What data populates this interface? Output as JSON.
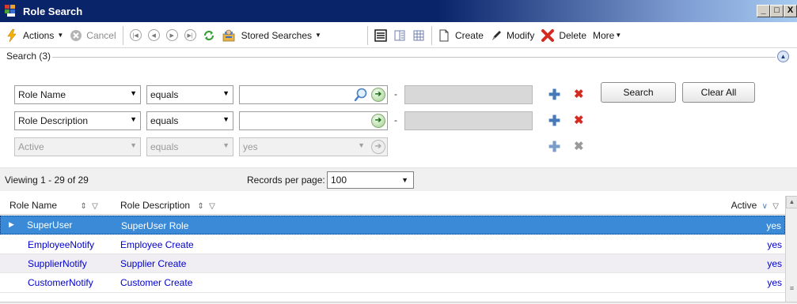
{
  "window": {
    "title": "Role Search",
    "minimize": "_",
    "maximize": "□",
    "close": "X"
  },
  "toolbar": {
    "actions": "Actions",
    "cancel": "Cancel",
    "stored_searches": "Stored Searches",
    "create": "Create",
    "modify": "Modify",
    "delete": "Delete",
    "more": "More"
  },
  "search": {
    "legend": "Search (3)",
    "rows": [
      {
        "field": "Role Name",
        "operator": "equals",
        "value": "",
        "range_to": ""
      },
      {
        "field": "Role Description",
        "operator": "equals",
        "value": "",
        "range_to": ""
      },
      {
        "field": "Active",
        "operator": "equals",
        "value": "yes"
      }
    ],
    "search_button": "Search",
    "clear_button": "Clear All",
    "range_separator": "-"
  },
  "paging": {
    "viewing": "Viewing 1 - 29  of  29",
    "records_label": "Records per page:",
    "records_value": "100"
  },
  "grid": {
    "columns": [
      "Role Name",
      "Role Description",
      "Active"
    ],
    "rows": [
      {
        "name": "SuperUser",
        "description": "SuperUser Role",
        "active": "yes"
      },
      {
        "name": "EmployeeNotify",
        "description": "Employee Create",
        "active": "yes"
      },
      {
        "name": "SupplierNotify",
        "description": "Supplier Create",
        "active": "yes"
      },
      {
        "name": "CustomerNotify",
        "description": "Customer Create",
        "active": "yes"
      }
    ]
  },
  "colors": {
    "titlebar": "#0a246a",
    "selected_row": "#3a8ad8",
    "link": "#0000cc",
    "add": "#4579b8",
    "remove": "#d42a20"
  },
  "icons": {
    "actions": "lightning-icon",
    "cancel": "cancel-circle-icon",
    "refresh": "refresh-icon",
    "stored_searches": "stored-searches-icon",
    "create": "document-icon",
    "modify": "pen-icon",
    "delete": "red-x-icon"
  }
}
